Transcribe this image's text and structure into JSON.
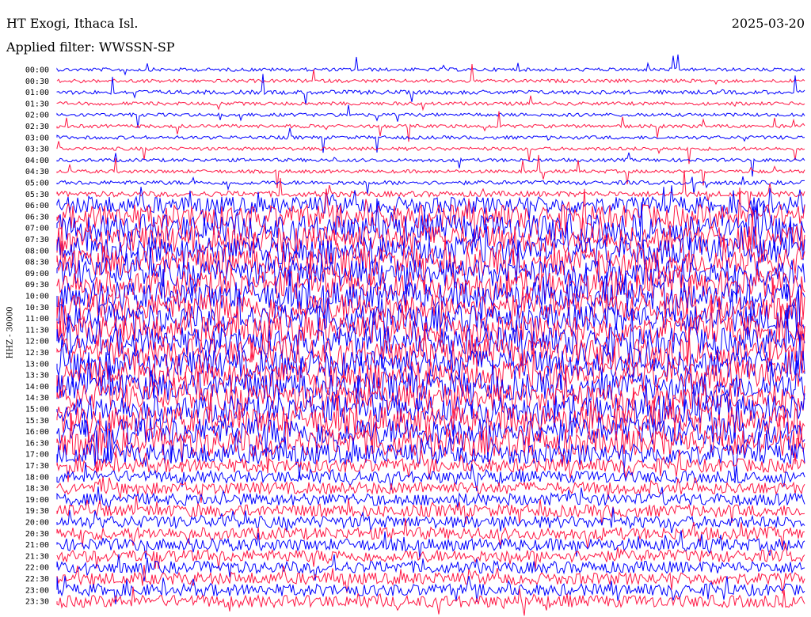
{
  "header": {
    "station": "HT Exogi, Ithaca Isl.",
    "date": "2025-03-20",
    "filter": "Applied filter: WWSSN-SP"
  },
  "chart_data": {
    "type": "line",
    "ylabel": "HHZ - 30000",
    "colors": {
      "even": "#0000ff",
      "odd": "#ff1744"
    },
    "rows": [
      {
        "label": "00:00",
        "level": 1
      },
      {
        "label": "00:30",
        "level": 1
      },
      {
        "label": "01:00",
        "level": 1.2
      },
      {
        "label": "01:30",
        "level": 1
      },
      {
        "label": "02:00",
        "level": 1
      },
      {
        "label": "02:30",
        "level": 1
      },
      {
        "label": "03:00",
        "level": 1
      },
      {
        "label": "03:30",
        "level": 1
      },
      {
        "label": "04:00",
        "level": 1
      },
      {
        "label": "04:30",
        "level": 1
      },
      {
        "label": "05:00",
        "level": 1.2
      },
      {
        "label": "05:30",
        "level": 1.6
      },
      {
        "label": "06:00",
        "level": 5
      },
      {
        "label": "06:30",
        "level": 7
      },
      {
        "label": "07:00",
        "level": 8
      },
      {
        "label": "07:30",
        "level": 8
      },
      {
        "label": "08:00",
        "level": 8
      },
      {
        "label": "08:30",
        "level": 8
      },
      {
        "label": "09:00",
        "level": 8
      },
      {
        "label": "09:30",
        "level": 8
      },
      {
        "label": "10:00",
        "level": 8
      },
      {
        "label": "10:30",
        "level": 8
      },
      {
        "label": "11:00",
        "level": 8
      },
      {
        "label": "11:30",
        "level": 8
      },
      {
        "label": "12:00",
        "level": 8
      },
      {
        "label": "12:30",
        "level": 8
      },
      {
        "label": "13:00",
        "level": 8
      },
      {
        "label": "13:30",
        "level": 8
      },
      {
        "label": "14:00",
        "level": 8
      },
      {
        "label": "14:30",
        "level": 8
      },
      {
        "label": "15:00",
        "level": 8
      },
      {
        "label": "15:30",
        "level": 8
      },
      {
        "label": "16:00",
        "level": 8
      },
      {
        "label": "16:30",
        "level": 8
      },
      {
        "label": "17:00",
        "level": 6
      },
      {
        "label": "17:30",
        "level": 4
      },
      {
        "label": "18:00",
        "level": 3.5
      },
      {
        "label": "18:30",
        "level": 3.5
      },
      {
        "label": "19:00",
        "level": 3.5
      },
      {
        "label": "19:30",
        "level": 3.5
      },
      {
        "label": "20:00",
        "level": 3.5
      },
      {
        "label": "20:30",
        "level": 3.5
      },
      {
        "label": "21:00",
        "level": 3.5
      },
      {
        "label": "21:30",
        "level": 3.5
      },
      {
        "label": "22:00",
        "level": 3.5
      },
      {
        "label": "22:30",
        "level": 3.5
      },
      {
        "label": "23:00",
        "level": 3.5
      },
      {
        "label": "23:30",
        "level": 3.5
      }
    ]
  }
}
